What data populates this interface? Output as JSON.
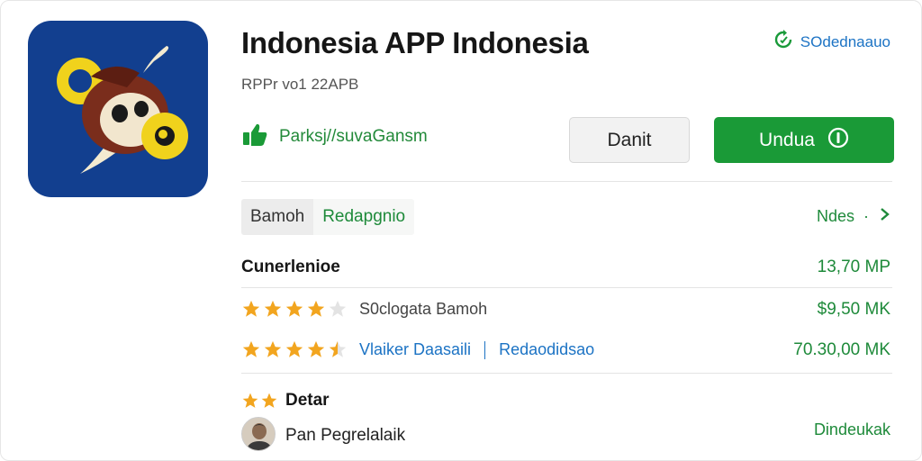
{
  "app": {
    "title": "Indonesia APP Indonesia",
    "subtitle": "RPPr vo1 22APB",
    "icon": "monkey-cymbal-app-icon",
    "icon_bg": "#123f8f"
  },
  "header": {
    "share_label": "SOdednaauo",
    "share_icon": "refresh-share-icon"
  },
  "permissions": {
    "label": "Parksj//suvaGansm",
    "icon": "thumbs-up-icon"
  },
  "actions": {
    "secondary_label": "Danit",
    "primary_label": "Undua",
    "primary_icon": "info-circle-icon",
    "primary_color": "#1a9a37"
  },
  "tabs": [
    {
      "label": "Bamoh",
      "active": true
    },
    {
      "label": "Redapgnio",
      "active": false
    }
  ],
  "more": {
    "label": "Ndes",
    "dot": "·"
  },
  "rows": {
    "heading": {
      "label": "Cunerlenioe",
      "value": "13,70 MP"
    },
    "items": [
      {
        "stars": 4,
        "text_muted": "S0clogata",
        "text_name": "Bamoh",
        "value": "$9,50 MK"
      },
      {
        "stars": 4.5,
        "text_blue": "Vlaiker Daasaili",
        "text_link": "Redaodidsao",
        "value": "70.30,00 MK"
      }
    ]
  },
  "detail": {
    "heading": "Detar",
    "stars": 2,
    "user_name": "Pan Pegrelalaik",
    "user_link": "Dindeukak"
  },
  "colors": {
    "green": "#1e8a3a",
    "blue": "#1c73c4",
    "star": "#f2a51f"
  }
}
